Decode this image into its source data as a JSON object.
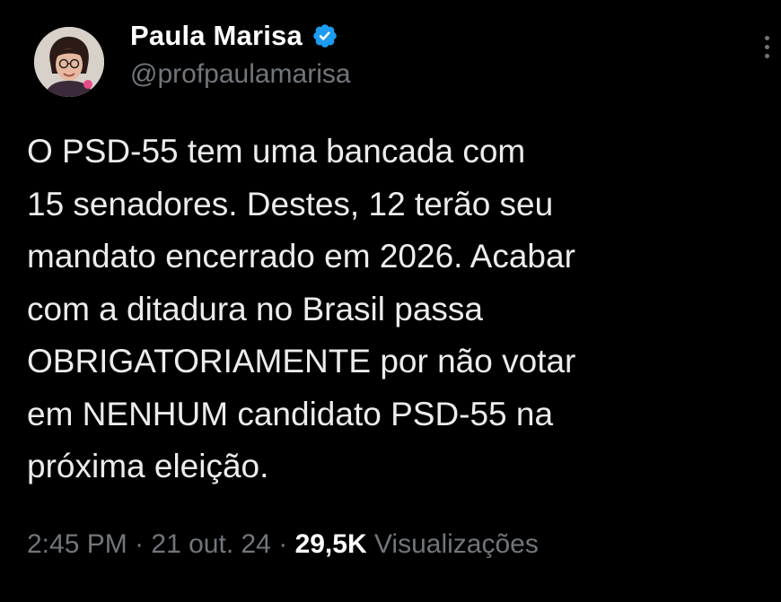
{
  "author": {
    "display_name": "Paula Marisa",
    "handle": "@profpaulamarisa",
    "verified": true
  },
  "tweet": {
    "lines": [
      "O PSD-55 tem uma bancada com",
      "15 senadores. Destes, 12 terão seu",
      "mandato encerrado em 2026. Acabar",
      "com a ditadura no Brasil passa",
      "OBRIGATORIAMENTE por não votar",
      "em NENHUM candidato PSD-55 na",
      "próxima eleição."
    ]
  },
  "meta": {
    "time": "2:45 PM",
    "sep": "·",
    "date": "21 out. 24",
    "views_count": "29,5K",
    "views_label": "Visualizações"
  },
  "colors": {
    "background": "#000000",
    "text": "#e7e9ea",
    "secondary": "#71767b",
    "verified_badge": "#1d9bf0"
  },
  "icons": {
    "verified": "verified-badge-icon",
    "more": "more-options-icon"
  }
}
